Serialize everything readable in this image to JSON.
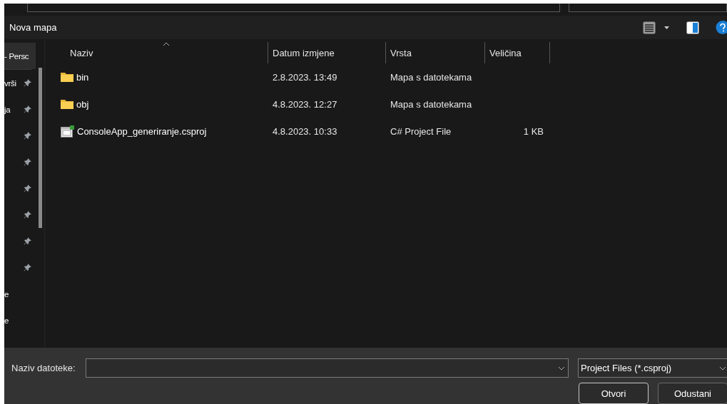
{
  "toolbar": {
    "new_folder": "Nova mapa"
  },
  "sidebar": {
    "items": [
      {
        "label": "- Persc",
        "pinned": false,
        "selected": true
      },
      {
        "label": "vrši",
        "pinned": true,
        "selected": false
      },
      {
        "label": "ja",
        "pinned": true,
        "selected": false
      },
      {
        "pinned": true,
        "selected": false
      },
      {
        "pinned": true,
        "selected": false
      },
      {
        "pinned": true,
        "selected": false
      },
      {
        "pinned": true,
        "selected": false
      },
      {
        "pinned": true,
        "selected": false
      },
      {
        "pinned": true,
        "selected": false
      },
      {
        "label": "e",
        "pinned": false,
        "selected": false
      },
      {
        "label": "e",
        "pinned": false,
        "selected": false
      }
    ]
  },
  "columns": [
    {
      "label": "Naziv",
      "sorted": true
    },
    {
      "label": "Datum izmjene"
    },
    {
      "label": "Vrsta"
    },
    {
      "label": "Veličina"
    }
  ],
  "files": [
    {
      "kind": "folder",
      "name": "bin",
      "modified": "2.8.2023. 13:49",
      "type": "Mapa s datotekama"
    },
    {
      "kind": "folder",
      "name": "obj",
      "modified": "4.8.2023. 12:27",
      "type": "Mapa s datotekama"
    },
    {
      "kind": "project",
      "name": "ConsoleApp_generiranje.csproj",
      "modified": "4.8.2023. 10:33",
      "type": "C# Project File",
      "size": "1 KB"
    }
  ],
  "footer": {
    "filename_label": "Naziv datoteke:",
    "filter": "Project Files (*.csproj)",
    "buttons": [
      "Otvori",
      "Odustani"
    ]
  }
}
